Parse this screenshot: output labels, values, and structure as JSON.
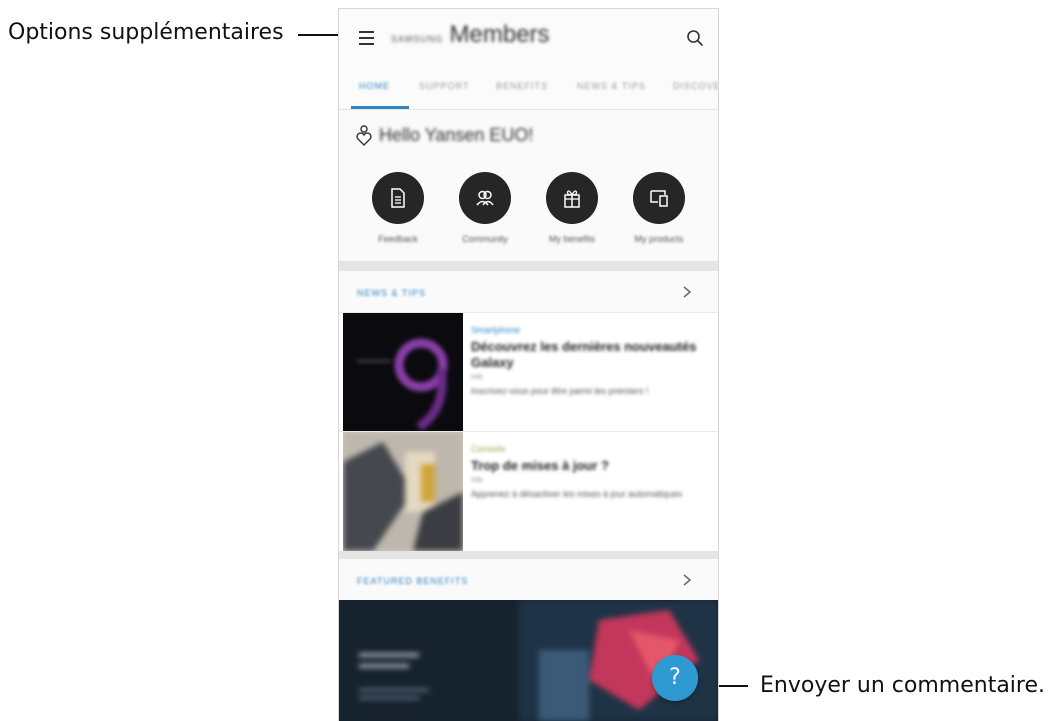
{
  "annotations": {
    "more_options": "Options supplémentaires",
    "send_feedback": "Envoyer un commentaire."
  },
  "app": {
    "brand": "SAMSUNG",
    "title": "Members",
    "search_icon": "search-icon",
    "menu_icon": "menu-icon"
  },
  "tabs": [
    "HOME",
    "SUPPORT",
    "BENEFITS",
    "NEWS & TIPS",
    "DISCOVER"
  ],
  "greeting": {
    "text": "Hello Yansen EUO!",
    "icon": "person-heart-icon"
  },
  "quick_actions": [
    {
      "label": "Feedback",
      "icon": "document-icon"
    },
    {
      "label": "Community",
      "icon": "people-icon"
    },
    {
      "label": "My benefits",
      "icon": "gift-icon"
    },
    {
      "label": "My products",
      "icon": "devices-icon"
    }
  ],
  "news_section": {
    "title": "NEWS & TIPS",
    "items": [
      {
        "category": "Smartphone",
        "title": "Découvrez les dernières nouveautés Galaxy",
        "source": "Info",
        "desc": "Inscrivez-vous pour être parmi les premiers !"
      },
      {
        "category": "Conseils",
        "title": "Trop de mises à jour ?",
        "source": "Info",
        "desc": "Apprenez à désactiver les mises à jour automatiques"
      }
    ]
  },
  "featured_section": {
    "title": "FEATURED BENEFITS"
  },
  "fab": {
    "label": "?",
    "icon": "help-icon"
  },
  "colors": {
    "accent": "#2e86c4",
    "fab": "#2f9ad1",
    "circle": "#262626"
  }
}
